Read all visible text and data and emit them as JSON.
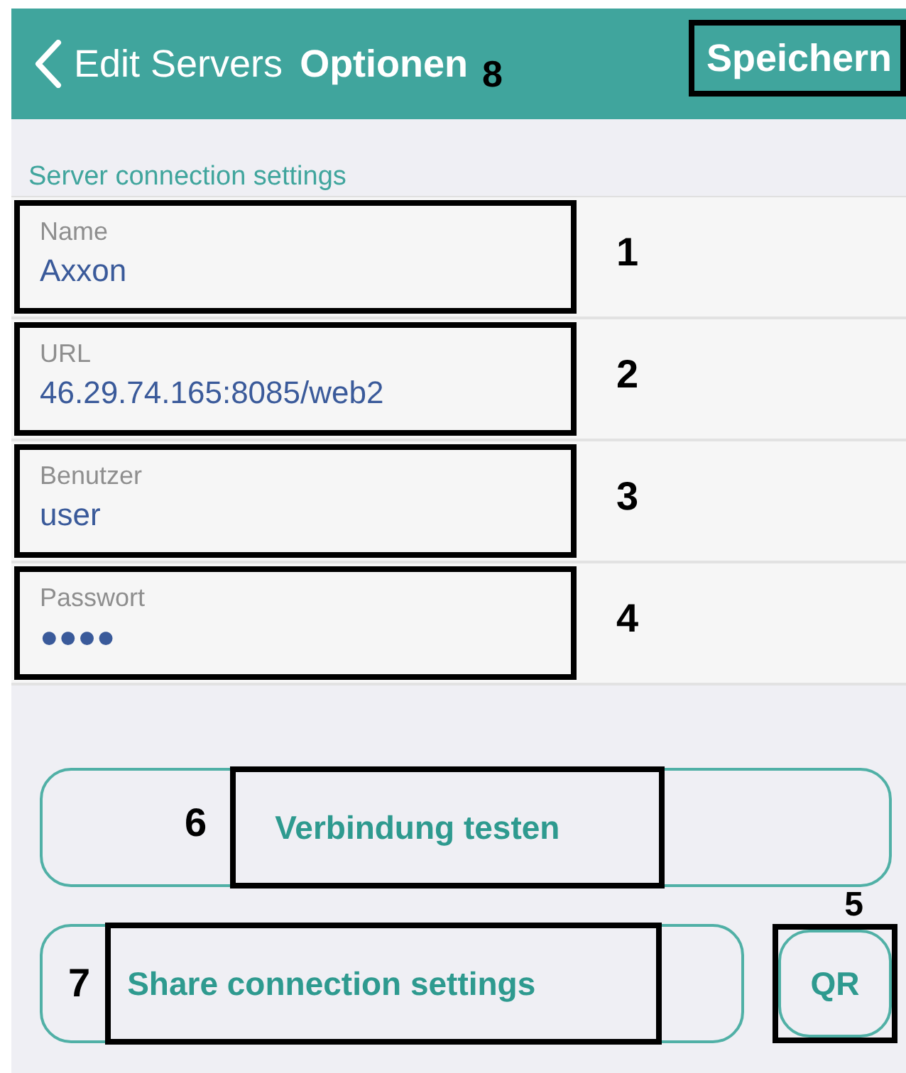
{
  "header": {
    "back_label": "Edit Servers",
    "title": "Optionen",
    "title_marker": "8",
    "save_button": "Speichern"
  },
  "section_title": "Server connection settings",
  "fields": [
    {
      "label": "Name",
      "value": "Axxon",
      "marker": "1"
    },
    {
      "label": "URL",
      "value": "46.29.74.165:8085/web2",
      "marker": "2"
    },
    {
      "label": "Benutzer",
      "value": "user",
      "marker": "3"
    },
    {
      "label": "Passwort",
      "value": "●●●●",
      "marker": "4"
    }
  ],
  "test_button": {
    "label": "Verbindung testen",
    "marker": "6"
  },
  "share_button": {
    "label": "Share connection settings",
    "marker": "7"
  },
  "qr_button": {
    "label": "QR",
    "marker": "5"
  }
}
